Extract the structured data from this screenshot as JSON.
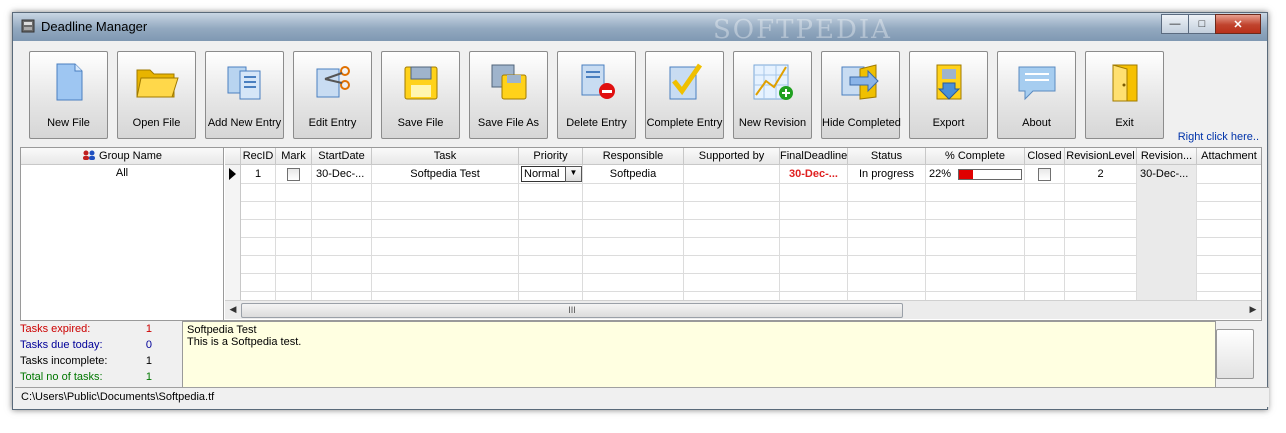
{
  "window": {
    "title": "Deadline Manager",
    "watermark": "SOFTPEDIA"
  },
  "toolbar": {
    "buttons": [
      {
        "label": "New File",
        "icon": "new-file-icon"
      },
      {
        "label": "Open File",
        "icon": "open-folder-icon"
      },
      {
        "label": "Add New Entry",
        "icon": "add-entry-icon"
      },
      {
        "label": "Edit Entry",
        "icon": "edit-entry-icon"
      },
      {
        "label": "Save File",
        "icon": "save-icon"
      },
      {
        "label": "Save File As",
        "icon": "save-as-icon"
      },
      {
        "label": "Delete Entry",
        "icon": "delete-entry-icon"
      },
      {
        "label": "Complete Entry",
        "icon": "complete-entry-icon"
      },
      {
        "label": "New Revision",
        "icon": "new-revision-icon"
      },
      {
        "label": "Hide Completed",
        "icon": "hide-completed-icon"
      },
      {
        "label": "Export",
        "icon": "export-icon"
      },
      {
        "label": "About",
        "icon": "about-icon"
      },
      {
        "label": "Exit",
        "icon": "exit-door-icon"
      }
    ],
    "right_click_hint": "Right click here.."
  },
  "groups": {
    "header": "Group Name",
    "items": [
      "All"
    ]
  },
  "grid": {
    "columns": [
      "RecID",
      "Mark",
      "StartDate",
      "Task",
      "Priority",
      "Responsible",
      "Supported by",
      "FinalDeadline",
      "Status",
      "% Complete",
      "Closed",
      "RevisionLevel",
      "Revision...",
      "Attachment"
    ],
    "rows": [
      {
        "recid": "1",
        "mark": false,
        "startdate": "30-Dec-...",
        "task": "Softpedia Test",
        "priority": "Normal",
        "responsible": "Softpedia",
        "supported_by": "",
        "final_deadline": "30-Dec-...",
        "status": "In progress",
        "percent_complete": "22%",
        "progress": 0.22,
        "closed": false,
        "revision_level": "2",
        "revision": "30-Dec-...",
        "attachment": ""
      }
    ],
    "scroll_thumb_label": "III"
  },
  "stats": [
    {
      "label": "Tasks expired:",
      "value": "1",
      "color": "#cc0000"
    },
    {
      "label": "Tasks due today:",
      "value": "0",
      "color": "#000099"
    },
    {
      "label": "Tasks incomplete:",
      "value": "1",
      "color": "#000000"
    },
    {
      "label": "Total no of tasks:",
      "value": "1",
      "color": "#007700"
    }
  ],
  "description": {
    "title": "Softpedia Test",
    "body": "This is a Softpedia test."
  },
  "statusbar": {
    "path": "C:\\Users\\Public\\Documents\\Softpedia.tf"
  },
  "colors": {
    "deadline_red": "#e02020",
    "progress_red": "#e00000",
    "hint_blue": "#0033aa"
  }
}
